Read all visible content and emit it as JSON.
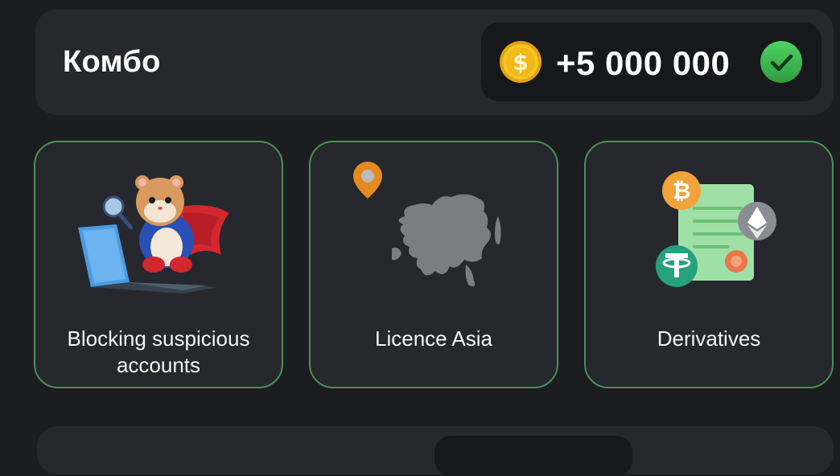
{
  "combo": {
    "title": "Комбо",
    "reward": "+5 000 000",
    "coin_icon": "dollar-coin-icon",
    "status_icon": "check-circle-icon"
  },
  "cards": [
    {
      "label": "Blocking suspicious accounts",
      "icon": "hamster-detective-laptop"
    },
    {
      "label": "Licence Asia",
      "icon": "asia-map-location"
    },
    {
      "label": "Derivatives",
      "icon": "crypto-contract"
    }
  ],
  "colors": {
    "background": "#1c1d21",
    "panel": "#26282d",
    "pill": "#17181b",
    "card_border": "#4a8f55",
    "coin_gold": "#f7c425",
    "check_green": "#3fbf52"
  }
}
